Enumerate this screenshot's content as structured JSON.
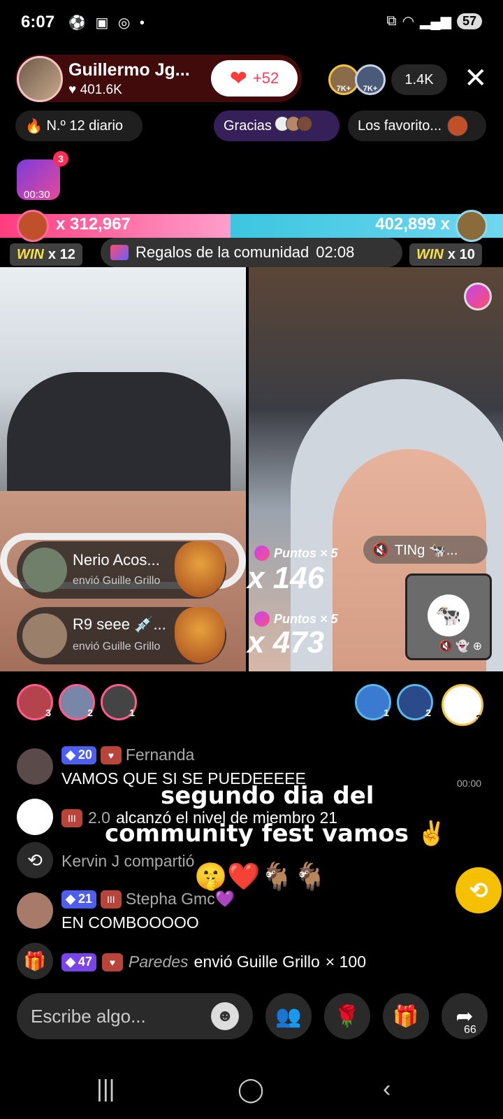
{
  "status": {
    "time": "6:07",
    "battery": "57"
  },
  "host": {
    "name": "Guillermo Jg...",
    "likes": "401.6K",
    "like_gain": "+52"
  },
  "viewers": {
    "badge1": "7K+",
    "badge2": "7K+",
    "count": "1.4K"
  },
  "chips": {
    "rank": "N.º 12 diario",
    "gracias": "Gracias",
    "favoritos": "Los favorito..."
  },
  "boost": {
    "badge": "3",
    "time": "00:30"
  },
  "battle": {
    "left_score": "x 312,967",
    "right_score": "402,899 x",
    "win_word": "WIN",
    "left_wins": "x 12",
    "right_wins": "x 10",
    "community_label": "Regalos de la comunidad",
    "community_timer": "02:08"
  },
  "gifts": [
    {
      "name": "Nerio Acos...",
      "sub": "envió Guille Grillo"
    },
    {
      "name": "R9 seee 💉...",
      "sub": "envió Guille Grillo"
    }
  ],
  "points": [
    {
      "label": "Puntos × 5",
      "mult": "x 146"
    },
    {
      "label": "Puntos × 5",
      "mult": "x 473"
    }
  ],
  "ting": "TINg 🐄...",
  "gifters_left": [
    "3",
    "2",
    "1"
  ],
  "gifters_right": [
    "1",
    "2",
    "3"
  ],
  "chat": [
    {
      "level": "20",
      "user": "Fernanda",
      "text": "VAMOS QUE SI SE PUEDEEEEE"
    },
    {
      "user": "2.0",
      "text": "alcanzó el nivel de miembro 21"
    },
    {
      "text": "Kervin J compartió"
    },
    {
      "level": "21",
      "user": "Stepha Gmc💜",
      "text": "EN COMBOOOOO"
    },
    {
      "level": "47",
      "user": "Paredes",
      "text": "envió Guille Grillo",
      "count": "× 100"
    }
  ],
  "overlay": {
    "line1": "segundo dia del",
    "line2": "community fest vamos ✌️",
    "emojis": "🤫❤️🐐🐐",
    "timer": "00:00"
  },
  "input": {
    "placeholder": "Escribe algo..."
  },
  "share_count": "66"
}
